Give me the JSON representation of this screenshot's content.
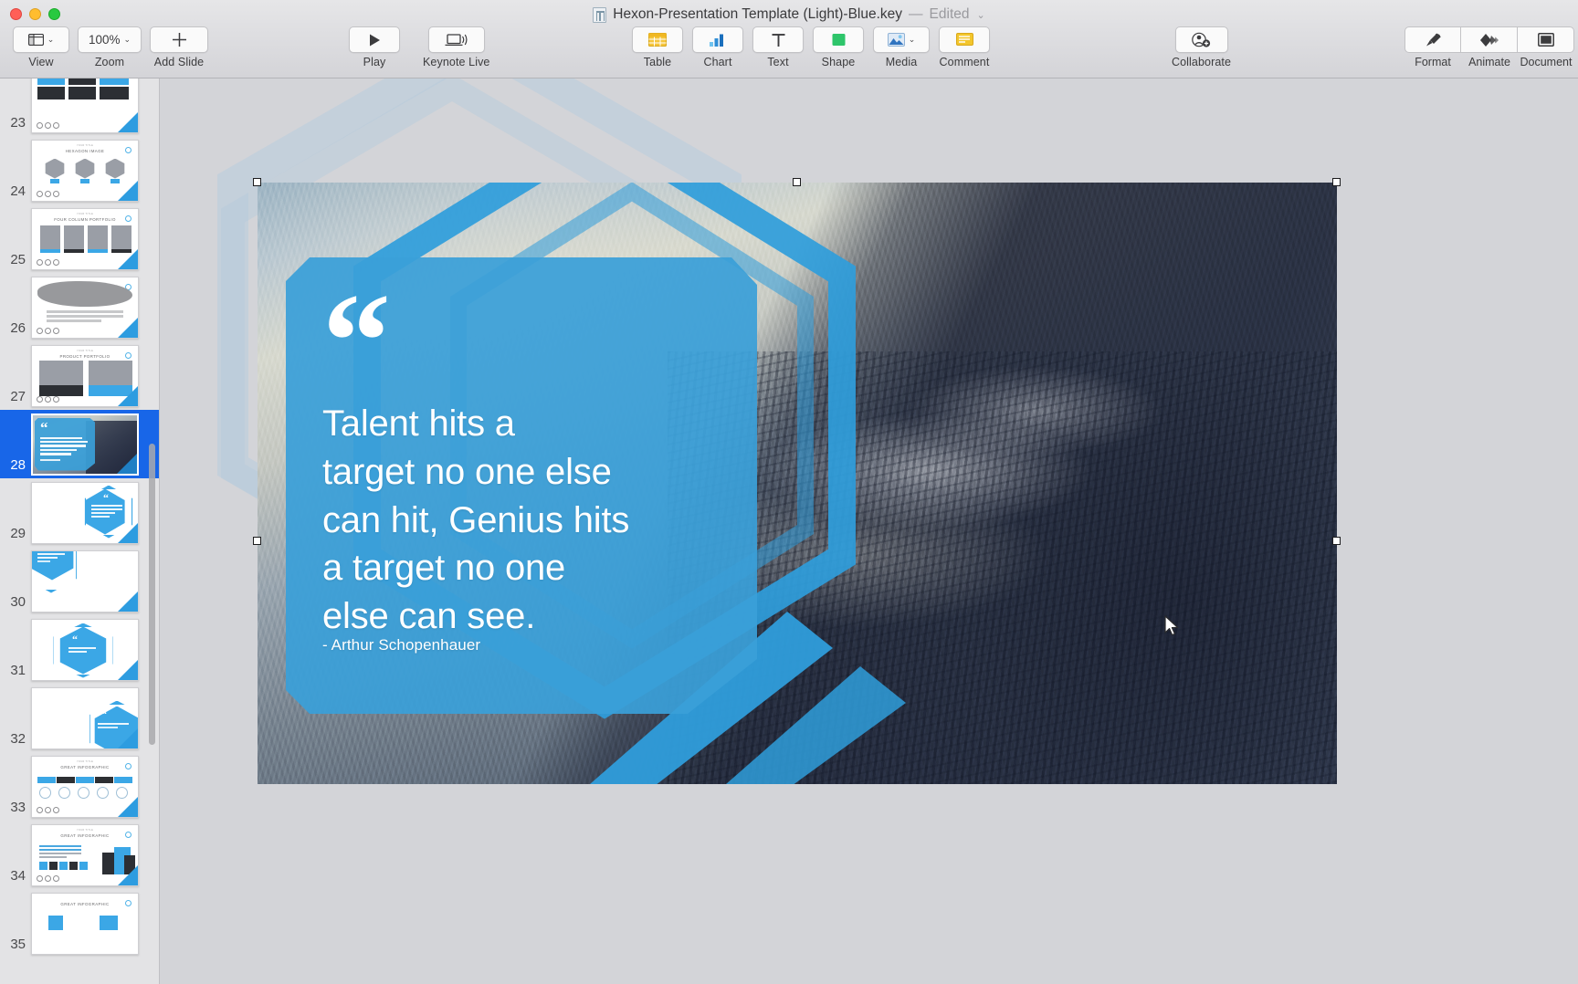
{
  "window": {
    "title": "Hexon-Presentation Template (Light)-Blue.key",
    "separator": "—",
    "edited_state": "Edited",
    "edited_chevron": "⌄",
    "doc_icon": "keynote-document-icon",
    "traffic_lights": [
      "close-button",
      "minimize-button",
      "zoom-button"
    ]
  },
  "toolbar": {
    "view": {
      "label": "View",
      "icon": "sidebar-layout-icon",
      "chevron": "⌄"
    },
    "zoom": {
      "label": "Zoom",
      "value": "100%",
      "chevron": "⌄"
    },
    "add_slide": {
      "label": "Add Slide",
      "icon": "plus-icon"
    },
    "play": {
      "label": "Play",
      "icon": "play-triangle-icon"
    },
    "keynote_live": {
      "label": "Keynote Live",
      "icon": "laptop-broadcast-icon"
    },
    "table": {
      "label": "Table",
      "icon": "table-grid-icon"
    },
    "chart": {
      "label": "Chart",
      "icon": "bar-chart-icon"
    },
    "text": {
      "label": "Text",
      "icon": "text-t-icon"
    },
    "shape": {
      "label": "Shape",
      "icon": "green-square-shape-icon"
    },
    "media": {
      "label": "Media",
      "icon": "photo-icon",
      "chevron": "⌄"
    },
    "comment": {
      "label": "Comment",
      "icon": "comment-note-icon"
    },
    "collaborate": {
      "label": "Collaborate",
      "icon": "add-person-icon"
    },
    "format": {
      "label": "Format",
      "icon": "paintbrush-icon"
    },
    "animate": {
      "label": "Animate",
      "icon": "diamond-animate-icon"
    },
    "document": {
      "label": "Document",
      "icon": "document-frame-icon"
    }
  },
  "navigator": {
    "selected_slide": 28,
    "scrollbar": "navigator-scrollbar",
    "slides": [
      {
        "number": "23",
        "kind": "three-column-image",
        "title": "",
        "eyebrow": ""
      },
      {
        "number": "24",
        "kind": "three-hexagon",
        "title": "HEXAGON IMAGE",
        "eyebrow": "YOUR TITLE"
      },
      {
        "number": "25",
        "kind": "four-column",
        "title": "FOUR COLUMN PORTFOLIO",
        "eyebrow": "YOUR TITLE"
      },
      {
        "number": "26",
        "kind": "brush-stroke",
        "title": "",
        "eyebrow": ""
      },
      {
        "number": "27",
        "kind": "product-portfolio",
        "title": "PRODUCT PORTFOLIO",
        "eyebrow": "YOUR TITLE"
      },
      {
        "number": "28",
        "kind": "photo-quote",
        "title": "",
        "eyebrow": ""
      },
      {
        "number": "29",
        "kind": "hexagon-quote-right",
        "title": "",
        "eyebrow": ""
      },
      {
        "number": "30",
        "kind": "hexagon-quote-left",
        "title": "",
        "eyebrow": ""
      },
      {
        "number": "31",
        "kind": "hexagon-quote-center",
        "title": "",
        "eyebrow": ""
      },
      {
        "number": "32",
        "kind": "hexagon-quote-right2",
        "title": "",
        "eyebrow": ""
      },
      {
        "number": "33",
        "kind": "infographic-timeline",
        "title": "GREAT INFOGRAPHIC",
        "eyebrow": "YOUR TITLE"
      },
      {
        "number": "34",
        "kind": "infographic-blocks",
        "title": "GREAT INFOGRAPHIC",
        "eyebrow": "YOUR TITLE"
      },
      {
        "number": "35",
        "kind": "infographic-partial",
        "title": "GREAT INFOGRAPHIC",
        "eyebrow": ""
      }
    ]
  },
  "slide": {
    "quote_mark": "“",
    "quote_lines": [
      "Talent hits a",
      "target no one else",
      "can hit, Genius hits",
      "a target no one",
      "else can see."
    ],
    "quote_text": "Talent hits a target no one else can hit, Genius hits a target no one else can see.",
    "author": "- Arthur Schopenhauer",
    "selection_handles": 6
  },
  "colors": {
    "accent_blue": "#3a9fd8",
    "selection_blue": "#1866e8",
    "toolbar_bg": "#dcdcde",
    "canvas_bg": "#d3d4d8",
    "navigator_bg": "#e3e3e5",
    "shape_green": "#30c46a",
    "table_yellow": "#f2c12e",
    "comment_yellow": "#f0c020"
  }
}
